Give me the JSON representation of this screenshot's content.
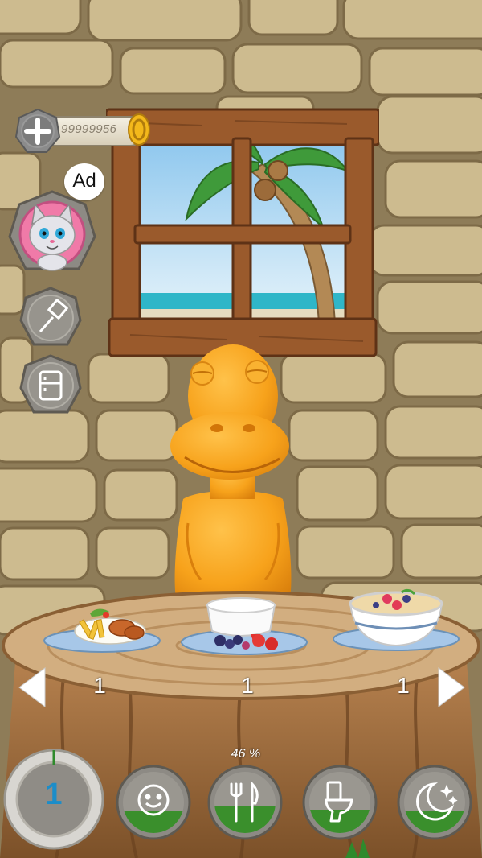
{
  "hud": {
    "coins": "99999956",
    "ad_label": "Ad",
    "food_percent": "46 %",
    "level": "1"
  },
  "foods": [
    {
      "name": "chicken wings and fries",
      "count": "1"
    },
    {
      "name": "yogurt with berries",
      "count": "1"
    },
    {
      "name": "oatmeal with berries",
      "count": "1"
    }
  ],
  "icons": {
    "add": "plus-icon",
    "coin": "coin-icon",
    "cat": "talking-cat-icon",
    "paint": "paintbrush-icon",
    "fridge": "fridge-icon",
    "mood": "smiley-icon",
    "food": "fork-knife-icon",
    "toilet": "toilet-icon",
    "sleep": "moon-stars-icon",
    "prev": "arrow-left-icon",
    "next": "arrow-right-icon"
  },
  "colors": {
    "pet": "#f7a21b",
    "wall": "#c9b68b",
    "meter_green": "#3a8f2c",
    "level_blue": "#1c8dc9"
  }
}
